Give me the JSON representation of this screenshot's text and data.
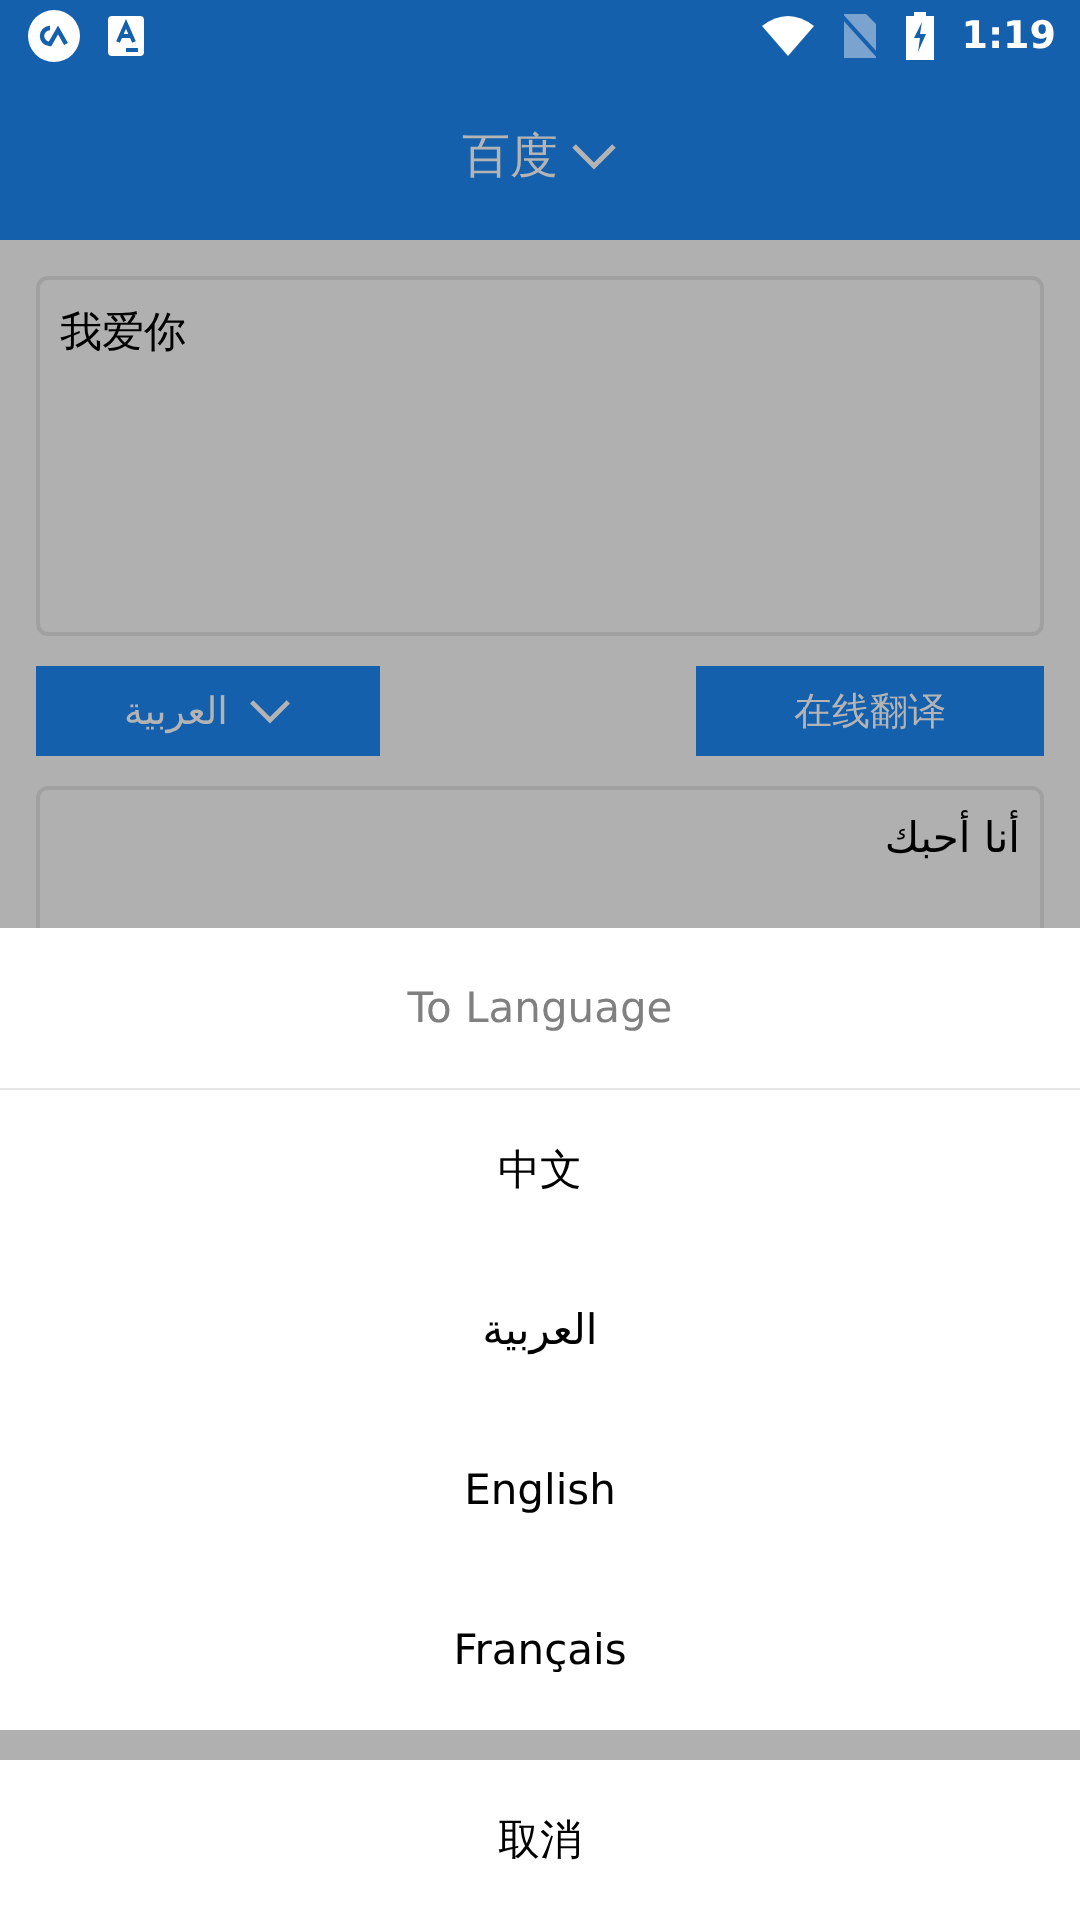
{
  "status_bar": {
    "time": "1:19"
  },
  "app_bar": {
    "title": "百度"
  },
  "source": {
    "value": "我爱你"
  },
  "language_button": {
    "label": "العربية"
  },
  "translate_button": {
    "label": "在线翻译"
  },
  "result": {
    "value": "أنا أحبك"
  },
  "sheet": {
    "title": "To Language",
    "options": [
      {
        "label": "中文"
      },
      {
        "label": "العربية"
      },
      {
        "label": "English"
      },
      {
        "label": "Français"
      }
    ],
    "cancel": "取消"
  }
}
